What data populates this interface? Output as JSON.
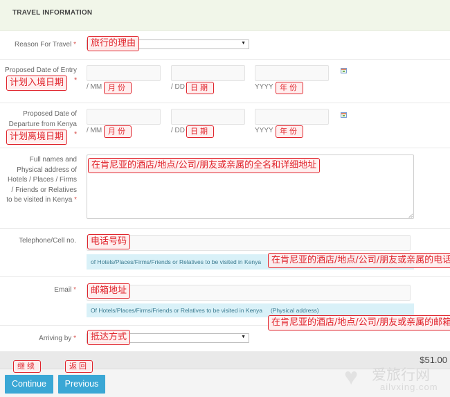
{
  "header": {
    "title": "TRAVEL INFORMATION"
  },
  "required_marker": "*",
  "reason": {
    "label": "Reason For Travel",
    "selected": "",
    "arrow": "▼",
    "annotation": "旅行的理由"
  },
  "entry_date": {
    "label": "Proposed Date of Entry",
    "annotation": "计划入境日期",
    "month": {
      "value": "",
      "sub": "/ MM",
      "annotation": "月份"
    },
    "day": {
      "value": "",
      "sub": "/ DD",
      "annotation": "日期"
    },
    "year": {
      "value": "",
      "sub": "YYYY",
      "annotation": "年份"
    },
    "icon": "calendar-icon"
  },
  "departure_date": {
    "label_line1": "Proposed Date of",
    "label_line2": "Departure from Kenya",
    "annotation": "计划离境日期",
    "month": {
      "value": "",
      "sub": "/ MM",
      "annotation": "月份"
    },
    "day": {
      "value": "",
      "sub": "/ DD",
      "annotation": "日期"
    },
    "year": {
      "value": "",
      "sub": "YYYY",
      "annotation": "年份"
    },
    "icon": "calendar-icon"
  },
  "address": {
    "label_lines": [
      "Full names and",
      "Physical address of",
      "Hotels / Places / Firms",
      "/ Friends or Relatives",
      "to be visited in Kenya"
    ],
    "value": "",
    "annotation": "在肯尼亚的酒店/地点/公司/朋友或亲属的全名和详细地址"
  },
  "telephone": {
    "label": "Telephone/Cell no.",
    "value": "",
    "annotation": "电话号码",
    "help": "of Hotels/Places/Firms/Friends or Relatives to be visited in Kenya",
    "help_annotation": "在肯尼亚的酒店/地点/公司/朋友或亲属的电话"
  },
  "email": {
    "label": "Email",
    "value": "",
    "annotation": "邮箱地址",
    "help": "Of Hotels/Places/Firms/Friends or Relatives to be visited in Kenya     (Physical address)",
    "help_annotation": "在肯尼亚的酒店/地点/公司/朋友或亲属的邮箱"
  },
  "arriving": {
    "label": "Arriving by",
    "selected": "",
    "arrow": "▼",
    "annotation": "抵达方式"
  },
  "footer": {
    "price": "$51.00",
    "continue_label": "Continue",
    "continue_annotation": "继续",
    "previous_label": "Previous",
    "previous_annotation": "返回"
  },
  "watermark": {
    "heart": "♥",
    "text_cn": "爱旅行网",
    "text_en": "ailvxing.com"
  }
}
